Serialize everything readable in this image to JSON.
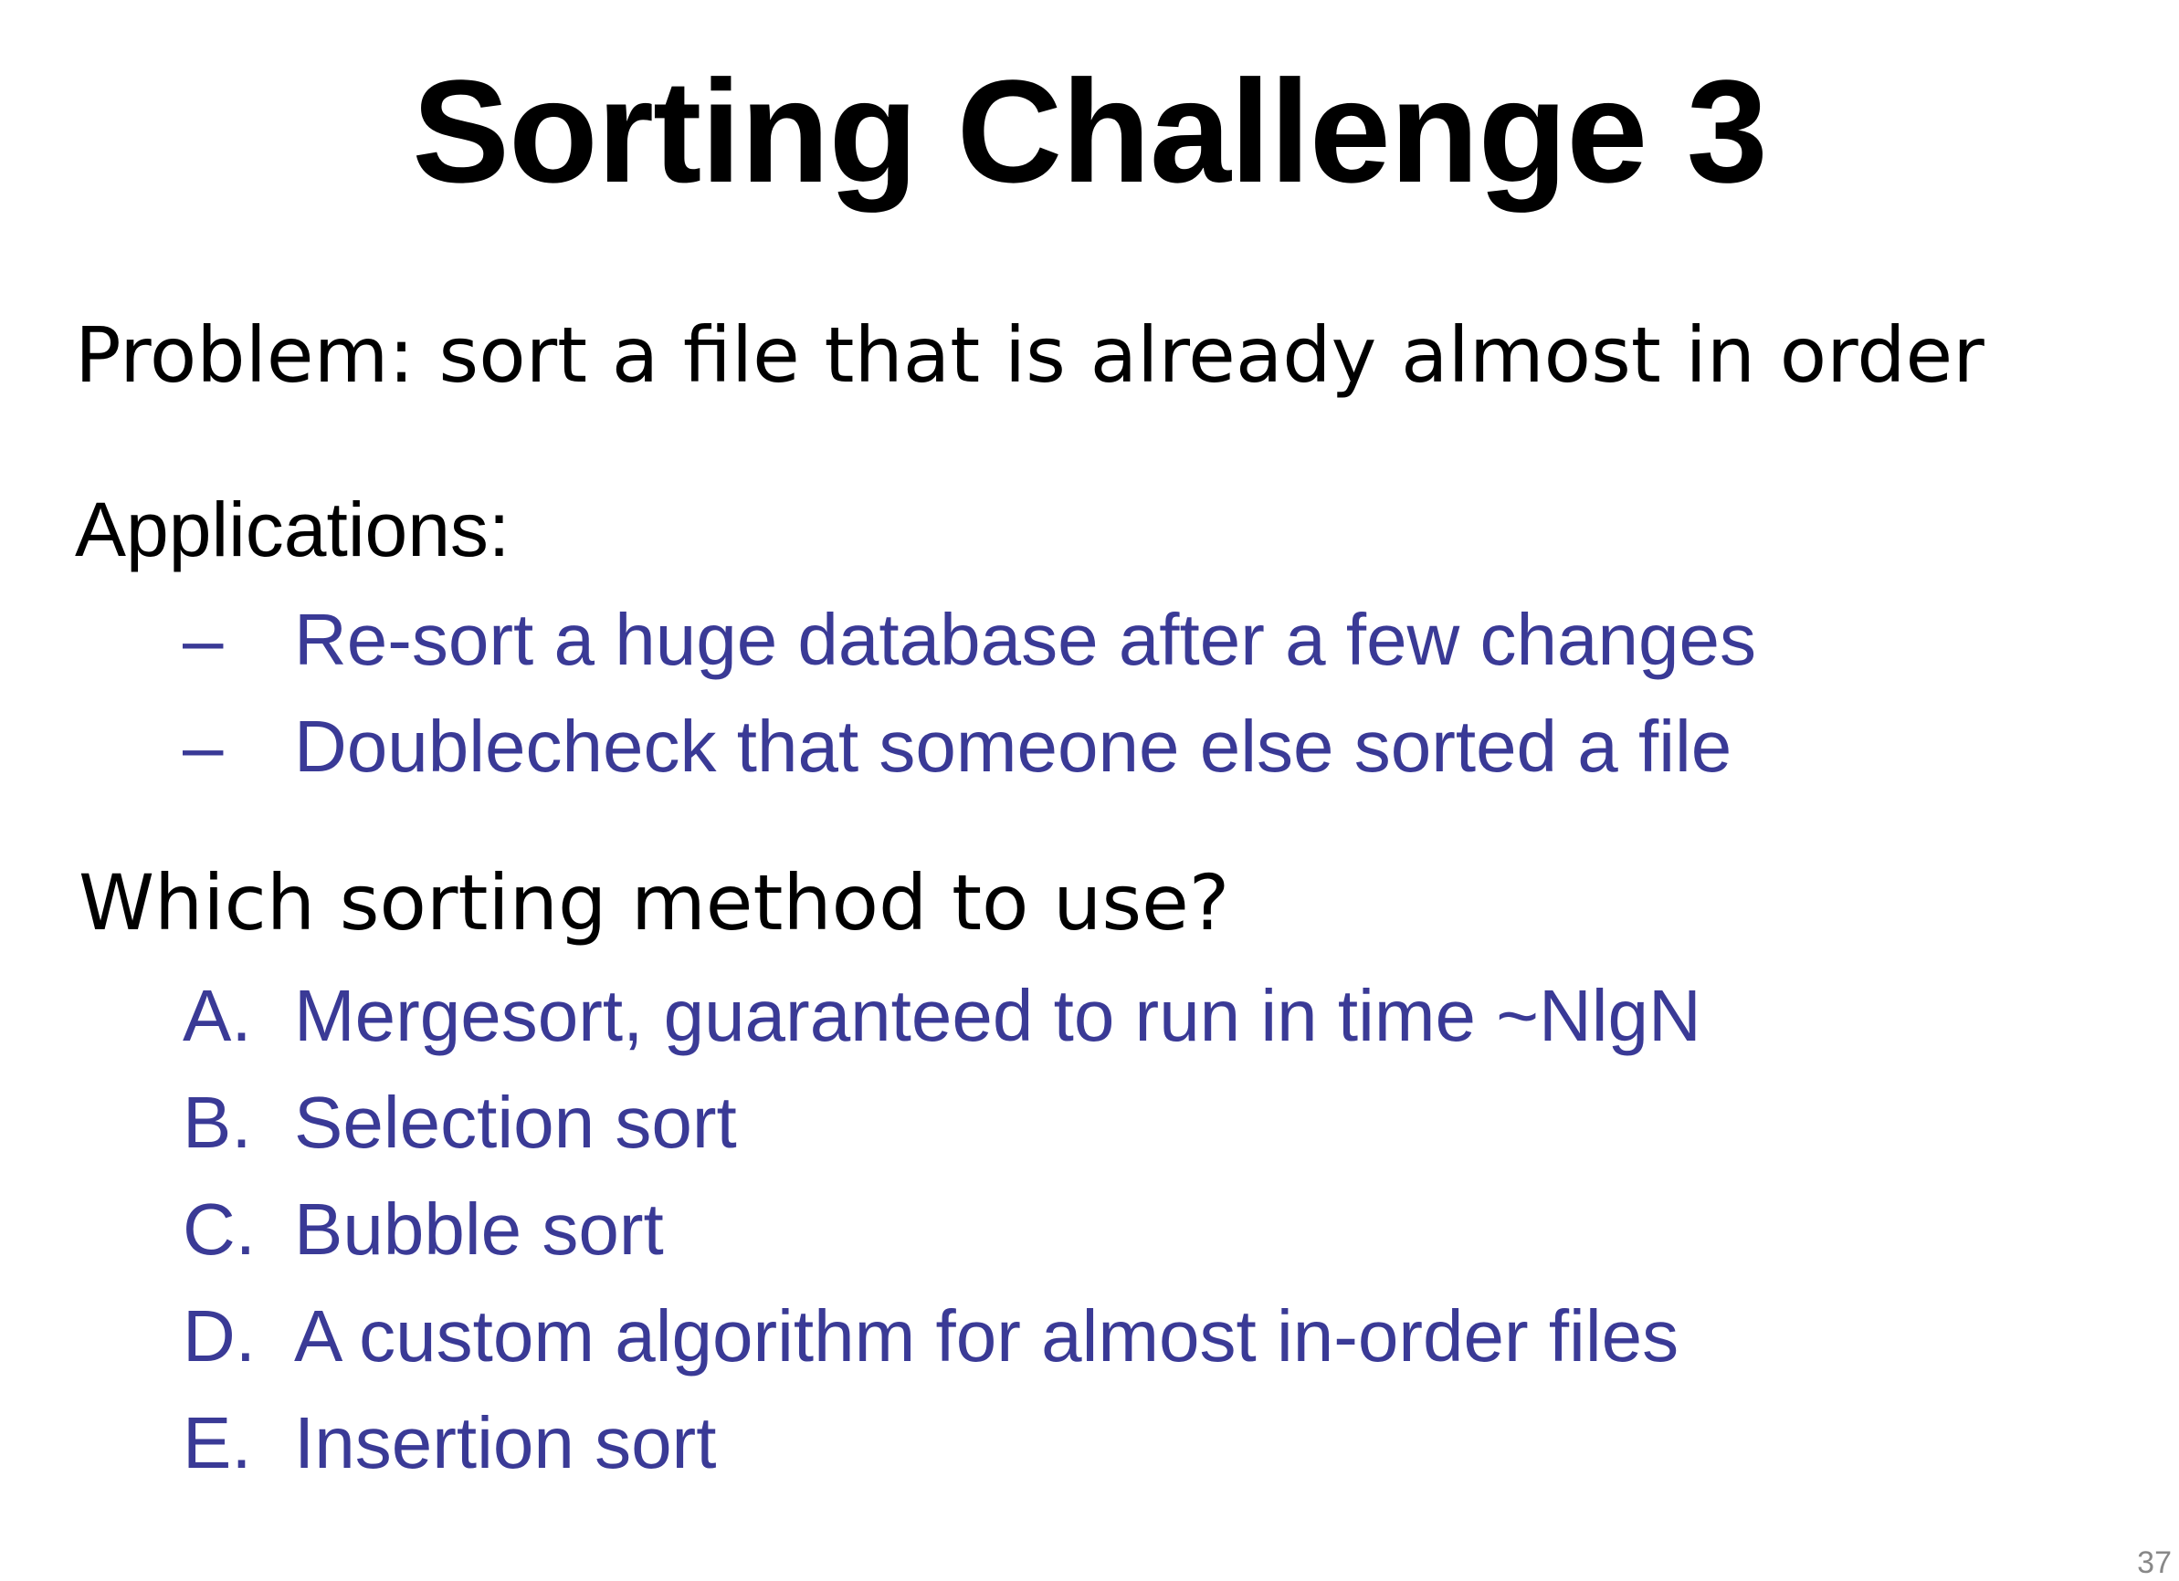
{
  "slide": {
    "title": "Sorting Challenge 3",
    "problem": "Problem: sort a file that is already almost in order",
    "applications_heading": "Applications:",
    "applications": [
      {
        "marker": "–",
        "text": "Re-sort a huge database after a few changes"
      },
      {
        "marker": "–",
        "text": "Doublecheck that someone else sorted a file"
      }
    ],
    "question": "Which sorting method to use?",
    "options": [
      {
        "marker": "A.",
        "text": "Mergesort, guaranteed to run in time ~NlgN"
      },
      {
        "marker": "B.",
        "text": "Selection sort"
      },
      {
        "marker": "C.",
        "text": "Bubble sort"
      },
      {
        "marker": "D.",
        "text": "A custom algorithm for almost in-order files"
      },
      {
        "marker": "E.",
        "text": "Insertion sort"
      }
    ],
    "page_number": "37"
  },
  "colors": {
    "text": "#000000",
    "list_text": "#3a3a96",
    "background": "#ffffff"
  }
}
